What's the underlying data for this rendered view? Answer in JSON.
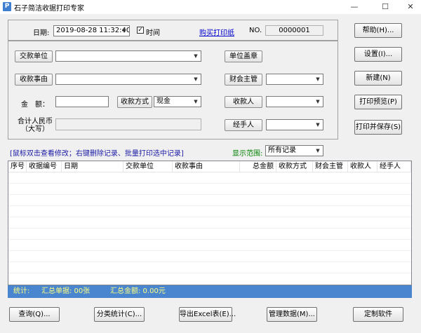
{
  "window": {
    "title": "石子简洁收据打印专家",
    "icon": "receipt-app-icon",
    "minimize": "—",
    "maximize": "☐",
    "close": "✕"
  },
  "form": {
    "date_label": "日期:",
    "date_value": "2019-08-28 11:32:40",
    "time_checkbox_label": "时间",
    "time_checked": true,
    "buy_paper_link": "购买打印纸",
    "no_label": "NO.",
    "no_value": "0000001",
    "payer_button": "交款单位",
    "payer_value": "",
    "reason_button": "收款事由",
    "reason_value": "",
    "amount_label": "金　额：",
    "amount_value": "",
    "payment_method_button": "收款方式",
    "payment_method_value": "现金",
    "total_rmb_label_line1": "合计人民币",
    "total_rmb_label_line2": "（大写）",
    "total_rmb_value": "",
    "seal_button": "单位盖章",
    "finance_manager_button": "财会主管",
    "finance_manager_value": "",
    "payee_button": "收款人",
    "payee_value": "",
    "handler_button": "经手人",
    "handler_value": ""
  },
  "side_buttons": {
    "help": "帮助(H)...",
    "settings": "设置(I)...",
    "new": "新建(N)",
    "print_preview": "打印预览(P)",
    "print_save": "打印并保存(S)"
  },
  "list": {
    "hint": "[鼠标双击查看修改；右键删除记录、批量打印选中记录]",
    "range_label": "显示范围:",
    "range_value": "所有记录",
    "columns": [
      "序号",
      "收据编号",
      "日期",
      "交款单位",
      "收款事由",
      "总金额",
      "收款方式",
      "财会主管",
      "收款人",
      "经手人"
    ]
  },
  "status": {
    "stats_label": "统计:",
    "total_receipts": "汇总单据: 00张",
    "total_amount": "汇总金额: 0.00元"
  },
  "bottom_buttons": {
    "query": "查询(Q)...",
    "category_stats": "分类统计(C)...",
    "export_excel": "导出Excel表(E)...",
    "manage_data": "管理数据(M)...",
    "custom_software": "定制软件"
  },
  "colors": {
    "status_bar": "#4a86cf",
    "status_text": "#ffff80",
    "hint_text": "#1a1aa6",
    "range_label": "#008000",
    "link": "#0000cc"
  }
}
